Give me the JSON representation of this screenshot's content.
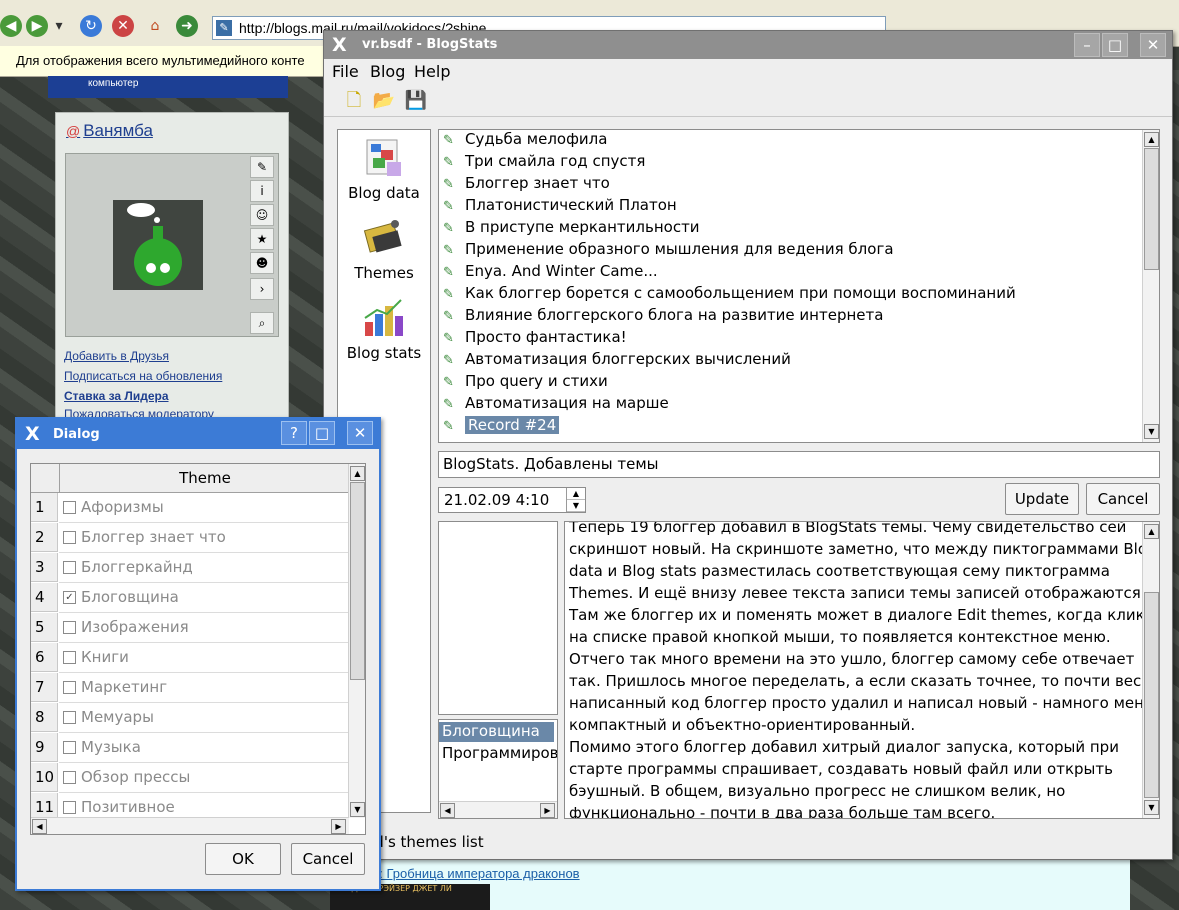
{
  "browser": {
    "url": "http://blogs.mail.ru/mail/vokidocs/?shine...",
    "info_bar": "Для отображения всего мультимедийного конте",
    "banner_text": "компьютер",
    "profile": {
      "name": "Ванямба",
      "links": [
        "Добавить в Друзья",
        "Подписаться на обновления",
        "Ставка за Лидера",
        "Пожаловаться модератору"
      ]
    },
    "bottom_link": "3: Гробница императора драконов",
    "book_caption": "БРЕНДАН ФРЭЙЗЕР   ДЖЕТ ЛИ"
  },
  "main_window": {
    "title": "vr.bsdf - BlogStats",
    "menu": [
      "File",
      "Blog",
      "Help"
    ],
    "sidebar": [
      {
        "label": "Blog data",
        "icon": "blog-data-icon"
      },
      {
        "label": "Themes",
        "icon": "themes-icon"
      },
      {
        "label": "Blog stats",
        "icon": "blog-stats-icon"
      }
    ],
    "posts": [
      "Судьба мелофила",
      "Три смайла год спустя",
      "Блоггер знает что",
      "Платонистический Платон",
      "В приступе меркантильности",
      "Применение образного мышления для ведения блога",
      "Enya. And Winter Came...",
      "Как блоггер борется с самообольщением при помощи воспоминаний",
      "Влияние блоггерского блога на развитие интернета",
      "Просто фантастика!",
      "Автоматизация блоггерских вычислений",
      "Про query и стихи",
      "Автоматизация на марше",
      "Record #24"
    ],
    "selected_post": "Record #24",
    "record_title": "BlogStats. Добавлены темы",
    "record_date": "21.02.09 4:10",
    "update_label": "Update",
    "cancel_label": "Cancel",
    "record_themes": [
      "Блоговщина",
      "Программирование"
    ],
    "record_text": [
      "Теперь 19 блоггер добавил в BlogStats темы. Чему свидетельство сей",
      "скриншот новый. На скриншоте заметно, что между пиктограммами Blog",
      "data и Blog stats разместилась соответствующая сему пиктограмма",
      "Themes. И ещё внизу левее текста записи темы записей отображаются.",
      "Там же блоггер их и поменять может в диалоге Edit themes, когда кликает",
      "на списке правой кнопкой мыши, то появляется контекстное меню.",
      "Отчего так много времени на это ушло, блоггер самому себе отвечает",
      "так. Пришлось многое переделать, а если сказать точнее, то почти весь",
      "написанный код блоггер просто удалил и написал новый - намного менее",
      "компактный и объектно-ориентированный.",
      "Помимо этого блоггер добавил хитрый диалог запуска, который при",
      "старте программы спрашивает, создавать новый файл или открыть",
      "бэушный. В общем, визуально прогресс не слишком велик, но",
      "функционально - почти в два раза больше там всего."
    ],
    "status": "Record's themes list"
  },
  "dialog": {
    "title": "Dialog",
    "column": "Theme",
    "rows": [
      {
        "n": "1",
        "name": "Афоризмы",
        "checked": false
      },
      {
        "n": "2",
        "name": "Блоггер знает что",
        "checked": false
      },
      {
        "n": "3",
        "name": "Блоггеркайнд",
        "checked": false
      },
      {
        "n": "4",
        "name": "Блоговщина",
        "checked": true
      },
      {
        "n": "5",
        "name": "Изображения",
        "checked": false
      },
      {
        "n": "6",
        "name": "Книги",
        "checked": false
      },
      {
        "n": "7",
        "name": "Маркетинг",
        "checked": false
      },
      {
        "n": "8",
        "name": "Мемуары",
        "checked": false
      },
      {
        "n": "9",
        "name": "Музыка",
        "checked": false
      },
      {
        "n": "10",
        "name": "Обзор прессы",
        "checked": false
      },
      {
        "n": "11",
        "name": "Позитивное",
        "checked": false
      }
    ],
    "ok_label": "OK",
    "cancel_label": "Cancel",
    "help_label": "?"
  },
  "colors": {
    "selection": "#6a88a8",
    "dialog_title": "#3c7bd6",
    "main_title": "#8f8f8f"
  }
}
